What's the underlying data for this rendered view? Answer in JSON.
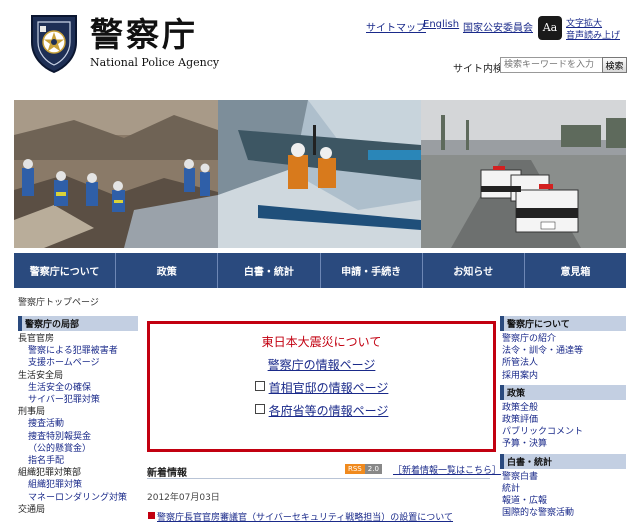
{
  "header": {
    "title": "警察庁",
    "subtitle": "National Police Agency",
    "links": [
      "サイトマップ",
      "English",
      "国家公安委員会"
    ],
    "accessibility": {
      "icon_text": "Aa",
      "lines": [
        "文字拡大",
        "音声読み上げ"
      ]
    },
    "search": {
      "label": "サイト内検索",
      "placeholder": "検索キーワードを入力",
      "button": "検索"
    }
  },
  "nav": [
    "警察庁について",
    "政策",
    "白書・統計",
    "申請・手続き",
    "お知らせ",
    "意見箱"
  ],
  "breadcrumb": "警察庁トップページ",
  "left_menu": {
    "heading": "警察庁の局部",
    "items": [
      {
        "text": "長官官房",
        "level": 0
      },
      {
        "text": "警察による犯罪被害者",
        "level": 1
      },
      {
        "text": "支援ホームページ",
        "level": 1
      },
      {
        "text": "生活安全局",
        "level": 0
      },
      {
        "text": "生活安全の確保",
        "level": 1
      },
      {
        "text": "サイバー犯罪対策",
        "level": 1
      },
      {
        "text": "刑事局",
        "level": 0
      },
      {
        "text": "捜査活動",
        "level": 1
      },
      {
        "text": "捜査特別報奨金",
        "level": 1
      },
      {
        "text": "（公的懸賞金）",
        "level": 1
      },
      {
        "text": "指名手配",
        "level": 1
      },
      {
        "text": "組織犯罪対策部",
        "level": 0
      },
      {
        "text": "組織犯罪対策",
        "level": 1
      },
      {
        "text": "マネーロンダリング対策",
        "level": 1
      },
      {
        "text": "交通局",
        "level": 0
      }
    ]
  },
  "quake_box": {
    "title": "東日本大震災について",
    "links": [
      "警察庁の情報ページ",
      "首相官邸の情報ページ",
      "各府省等の情報ページ"
    ]
  },
  "news": {
    "heading": "新着情報",
    "rss": [
      "RSS",
      "2.0"
    ],
    "list_link": "［新着情報一覧はこちら］",
    "date": "2012年07月03日",
    "item": "警察庁長官官房審議官（サイバーセキュリティ戦略担当）の設置について"
  },
  "right_menu": [
    {
      "heading": "警察庁について",
      "items": [
        "警察庁の紹介",
        "法令・訓令・通達等",
        "所管法人",
        "採用案内"
      ]
    },
    {
      "heading": "政策",
      "items": [
        "政策全般",
        "政策評価",
        "パブリックコメント",
        "予算・決算"
      ]
    },
    {
      "heading": "白書・統計",
      "items": [
        "警察白書",
        "統計",
        "報道・広報",
        "国際的な警察活動"
      ]
    }
  ],
  "colors": {
    "nav_bg": "#2a4a7e",
    "alert_red": "#c20010",
    "link": "#1a2a8a"
  }
}
